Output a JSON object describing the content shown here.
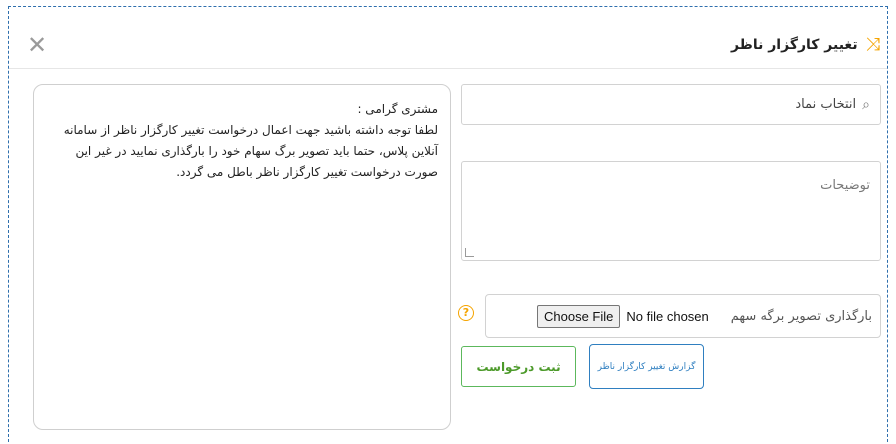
{
  "dialog": {
    "title": "تغییر کارگزار ناظر",
    "icons": {
      "title_icon": "shuffle-icon",
      "close_icon": "close-icon"
    },
    "colors": {
      "accent": "#f5a400",
      "frame": "#2f6fad",
      "submit": "#5cb85c",
      "report": "#2f7fc0"
    }
  },
  "notice": {
    "heading": "مشتری گرامی :",
    "body": "لطفا توجه داشته باشید جهت اعمال درخواست تغییر کارگزار ناظر از سامانه آنلاین پلاس، حتما باید تصویر برگ سهام خود را بارگذاری نمایید در غیر این صورت درخواست تغییر کارگزار ناظر باطل می گردد."
  },
  "form": {
    "symbol_placeholder": "انتخاب نماد",
    "description_placeholder": "توضیحات",
    "upload_label": "بارگذاری تصویر برگه سهم",
    "choose_file": "Choose File",
    "no_file": "No file chosen",
    "help": "?",
    "report_button": "گزارش تغییر کارگزار ناظر",
    "submit_button": "ثبت درخواست"
  }
}
